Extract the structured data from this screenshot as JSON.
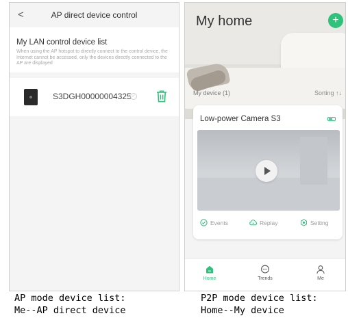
{
  "left_screen": {
    "title": "AP direct device control",
    "back_glyph": "<",
    "list_heading": "My LAN control device list",
    "note": "When using the AP hotspot to directly connect to the control device, the Internet cannot be accessed, only the devices directly connected to the AP are displayed",
    "device": {
      "name": "S3DGH00000004325",
      "thumbnail_icon": "camera-device-icon",
      "delete_icon": "trash-icon"
    }
  },
  "right_screen": {
    "title": "My home",
    "add_glyph": "+",
    "section_label": "My device (1)",
    "sorting_label": "Sorting ↑↓",
    "camera": {
      "name": "Low-power Camera S3",
      "actions": [
        "Events",
        "Replay",
        "Setting"
      ]
    },
    "tabs": [
      {
        "label": "Home",
        "active": true
      },
      {
        "label": "Trends",
        "active": false
      },
      {
        "label": "Me",
        "active": false
      }
    ]
  },
  "captions": {
    "left": "AP mode device list:\nMe--AP direct device",
    "right": "P2P mode device list:\nHome--My device"
  },
  "colors": {
    "accent": "#2fc27b",
    "panel_bg": "#f4f4f4",
    "text": "#333333"
  }
}
